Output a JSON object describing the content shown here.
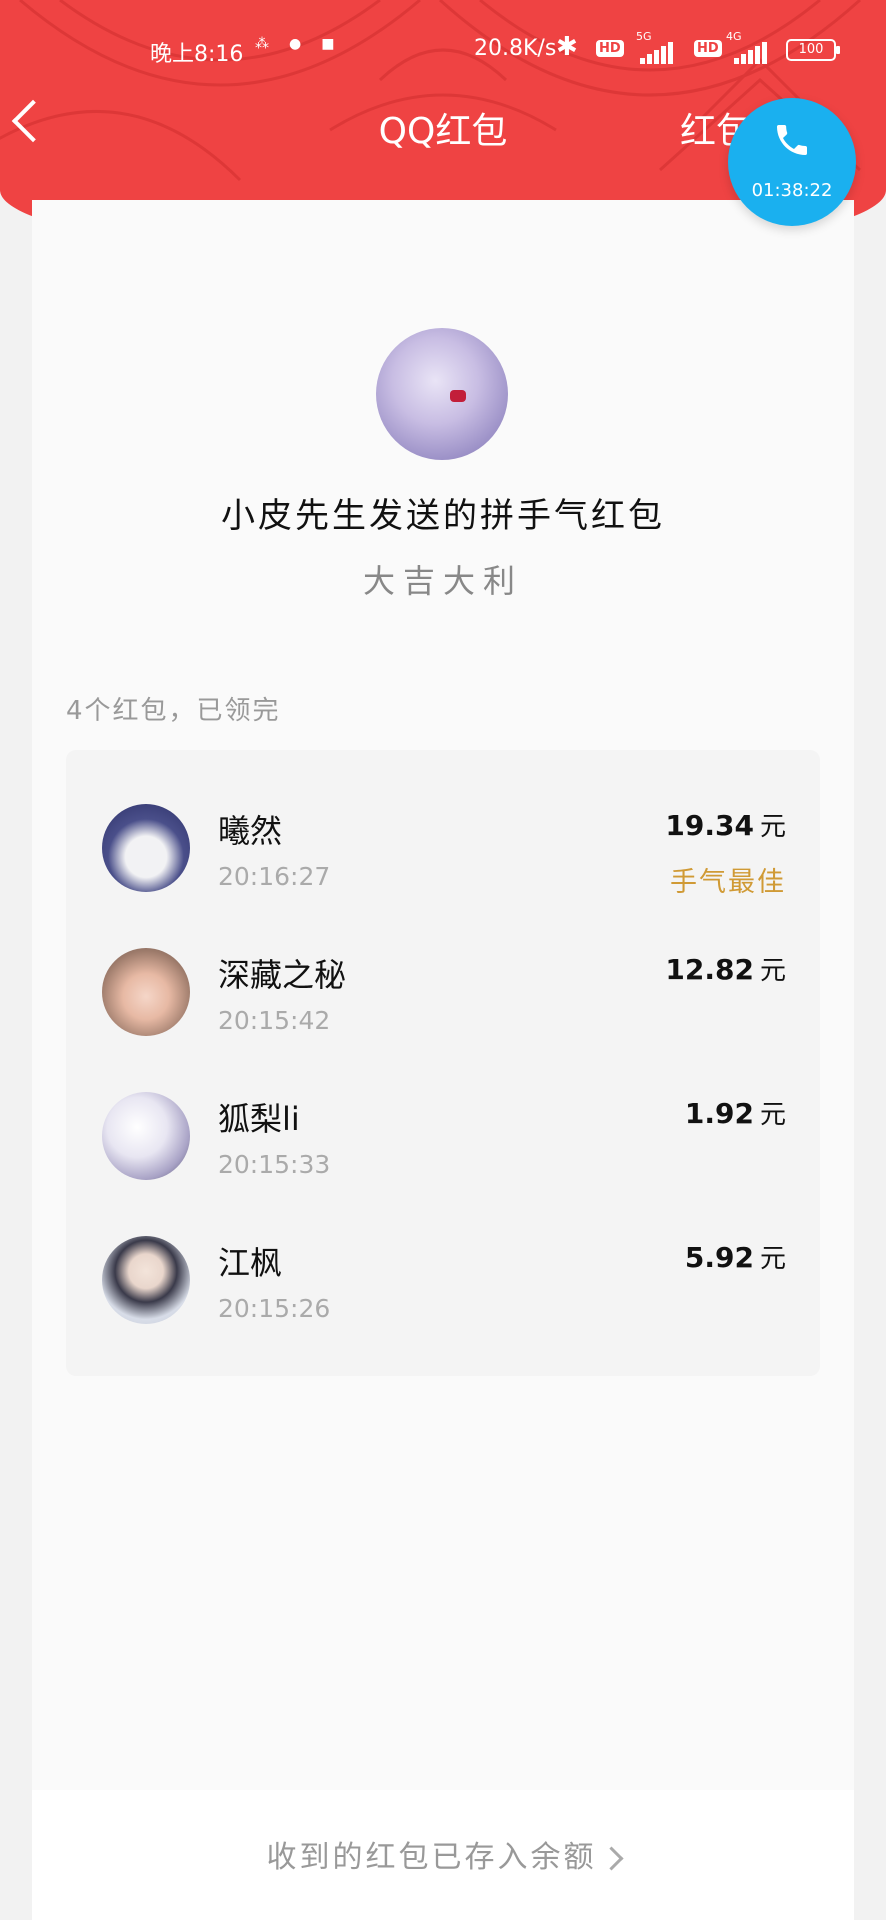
{
  "status_bar": {
    "time": "晚上8:16",
    "network_speed": "20.8K/s",
    "hd_label": "HD",
    "sim1_network": "5G",
    "sim2_network": "4G",
    "battery": "100"
  },
  "header": {
    "title": "QQ红包",
    "right_link": "红包",
    "background_color": "#ef4343"
  },
  "call_bubble": {
    "duration": "01:38:22",
    "color": "#1ab0ef",
    "icon": "phone-icon"
  },
  "packet": {
    "sender_title": "小皮先生发送的拼手气红包",
    "greeting": "大吉大利",
    "summary": "4个红包，已领完"
  },
  "recipients": [
    {
      "name": "曦然",
      "time": "20:16:27",
      "amount": "19.34",
      "unit": "元",
      "badge": "手气最佳"
    },
    {
      "name": "深藏之秘",
      "time": "20:15:42",
      "amount": "12.82",
      "unit": "元"
    },
    {
      "name": "狐梨li",
      "time": "20:15:33",
      "amount": "1.92",
      "unit": "元"
    },
    {
      "name": "江枫",
      "time": "20:15:26",
      "amount": "5.92",
      "unit": "元"
    }
  ],
  "footer": {
    "text": "收到的红包已存入余额"
  }
}
